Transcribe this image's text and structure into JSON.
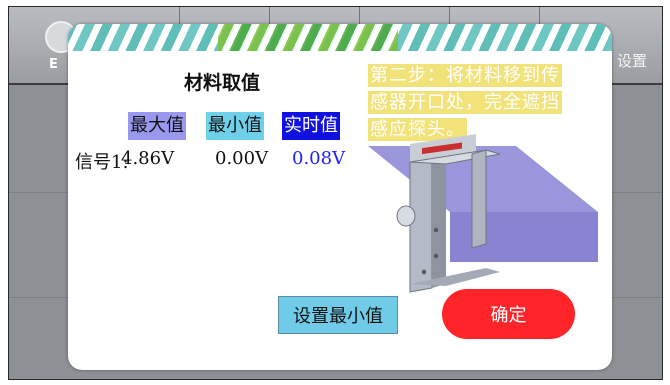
{
  "nav": {
    "settings_label": "设置",
    "left_label": "E"
  },
  "dialog": {
    "title": "材料取值",
    "headers": {
      "max": "最大值",
      "min": "最小值",
      "realtime": "实时值"
    },
    "signal": {
      "label": "信号1:",
      "max": "4.86V",
      "min": "0.00V",
      "realtime": "0.08V"
    },
    "instruction_lines": [
      "第二步：将材料移到传",
      "感器开口处，完全遮挡",
      "感应探头。"
    ],
    "set_min_button": "设置最小值",
    "ok_button": "确定"
  },
  "colors": {
    "max_header_bg": "#9898ee",
    "min_header_bg": "#6fd0ea",
    "realtime_header_bg": "#1010e0",
    "realtime_value": "#2222ff",
    "instruction_bg": "#f2e27a",
    "ok_button": "#ff2428",
    "set_min_button": "#6fcbe8"
  }
}
